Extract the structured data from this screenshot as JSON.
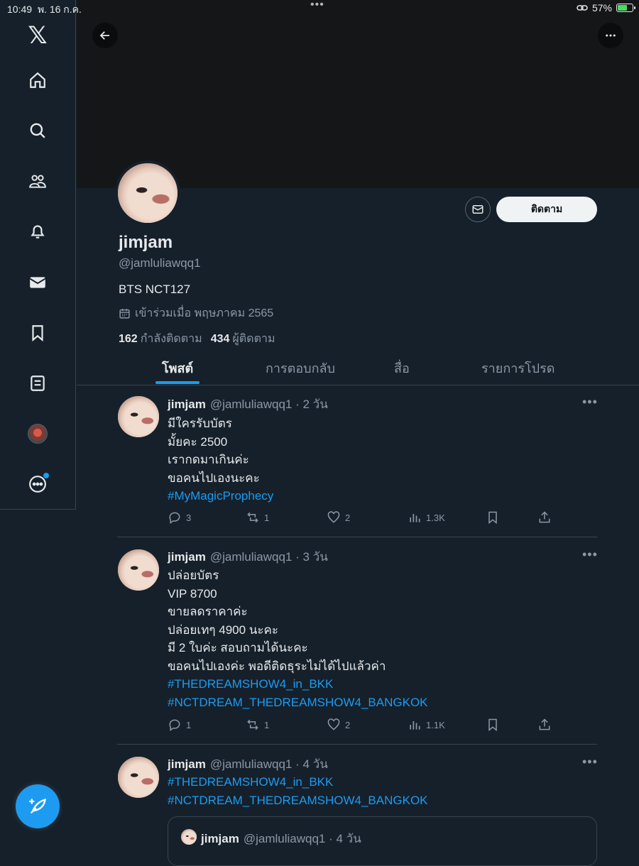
{
  "statusbar": {
    "time": "10:49",
    "date": "พ. 16 ก.ค.",
    "dots": "•••",
    "battery": "57%",
    "battery_level": 0.57
  },
  "sidebar": {
    "items": [
      "x-logo-icon",
      "home-icon",
      "search-icon",
      "communities-icon",
      "notifications-icon",
      "messages-icon",
      "bookmarks-icon",
      "lists-icon",
      "profile-avatar",
      "more-icon"
    ]
  },
  "profile": {
    "display_name": "jimjam",
    "handle": "@jamluliawqq1",
    "bio": "BTS NCT127",
    "joined": "เข้าร่วมเมื่อ พฤษภาคม 2565",
    "following_count": "162",
    "following_label": "กำลังติดตาม",
    "followers_count": "434",
    "followers_label": "ผู้ติดตาม",
    "follow_label": "ติดตาม"
  },
  "tabs": [
    "โพสต์",
    "การตอบกลับ",
    "สื่อ",
    "รายการโปรด"
  ],
  "tweets": [
    {
      "name": "jimjam",
      "meta": "@jamluliawqq1 · 2 วัน",
      "lines": [
        "มีใครรับบัตร",
        "มั้ยคะ 2500",
        "เรากดมาเกินค่ะ",
        "ขอคนไปเองนะคะ"
      ],
      "tags": [
        "#MyMagicProphecy"
      ],
      "replies": "3",
      "reposts": "1",
      "likes": "2",
      "views": "1.3K"
    },
    {
      "name": "jimjam",
      "meta": "@jamluliawqq1 · 3 วัน",
      "lines": [
        "ปล่อยบัตร",
        "VIP 8700",
        "ขายลดราคาค่ะ",
        "ปล่อยเทๆ 4900 นะคะ",
        "มี 2 ใบค่ะ สอบถามได้นะคะ",
        "ขอคนไปเองค่ะ พอดีติดธุระไม่ได้ไปแล้วค่า"
      ],
      "tags": [
        "#THEDREAMSHOW4_in_BKK",
        "#NCTDREAM_THEDREAMSHOW4_BANGKOK"
      ],
      "replies": "1",
      "reposts": "1",
      "likes": "2",
      "views": "1.1K"
    },
    {
      "name": "jimjam",
      "meta": "@jamluliawqq1 · 4 วัน",
      "lines": [],
      "tags": [
        "#THEDREAMSHOW4_in_BKK",
        "#NCTDREAM_THEDREAMSHOW4_BANGKOK"
      ],
      "quote": {
        "name": "jimjam",
        "meta": "@jamluliawqq1 · 4 วัน"
      }
    }
  ]
}
